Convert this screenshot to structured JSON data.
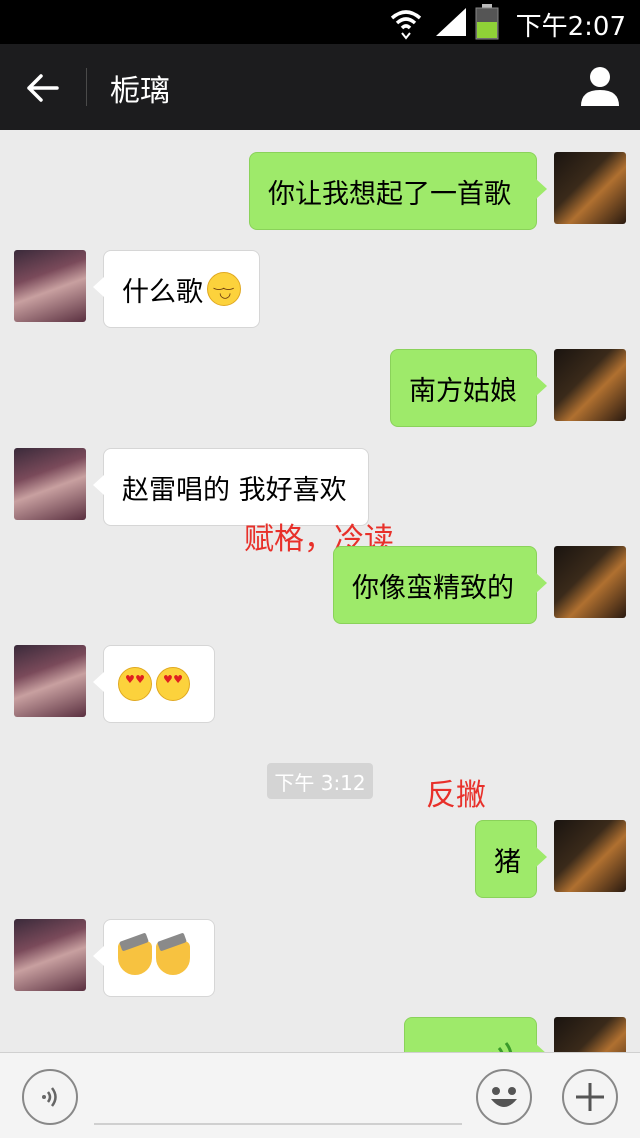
{
  "status_bar": {
    "time": "下午2:07"
  },
  "header": {
    "title": "栀璃"
  },
  "messages": [
    {
      "side": "me",
      "text": "你让我想起了一首歌"
    },
    {
      "side": "them",
      "text": "什么歌"
    },
    {
      "side": "me",
      "text": "南方姑娘"
    },
    {
      "side": "them",
      "text": "赵雷唱的 我好喜欢"
    },
    {
      "side": "me",
      "text": "你像蛮精致的"
    },
    {
      "side": "them",
      "text": ""
    },
    {
      "side": "me",
      "text": "猪"
    },
    {
      "side": "them",
      "text": ""
    },
    {
      "side": "me",
      "text": ""
    }
  ],
  "timestamp": "下午 3:12",
  "annotations": [
    "赋格，冷读",
    "反撇"
  ],
  "icons": {
    "back": "arrow-left-icon",
    "profile": "person-icon",
    "voice": "voice-icon",
    "emoji": "smiley-icon",
    "more": "plus-icon"
  },
  "colors": {
    "my_bubble": "#9eea6a",
    "their_bubble": "#ffffff",
    "annotation": "#e8302a"
  }
}
